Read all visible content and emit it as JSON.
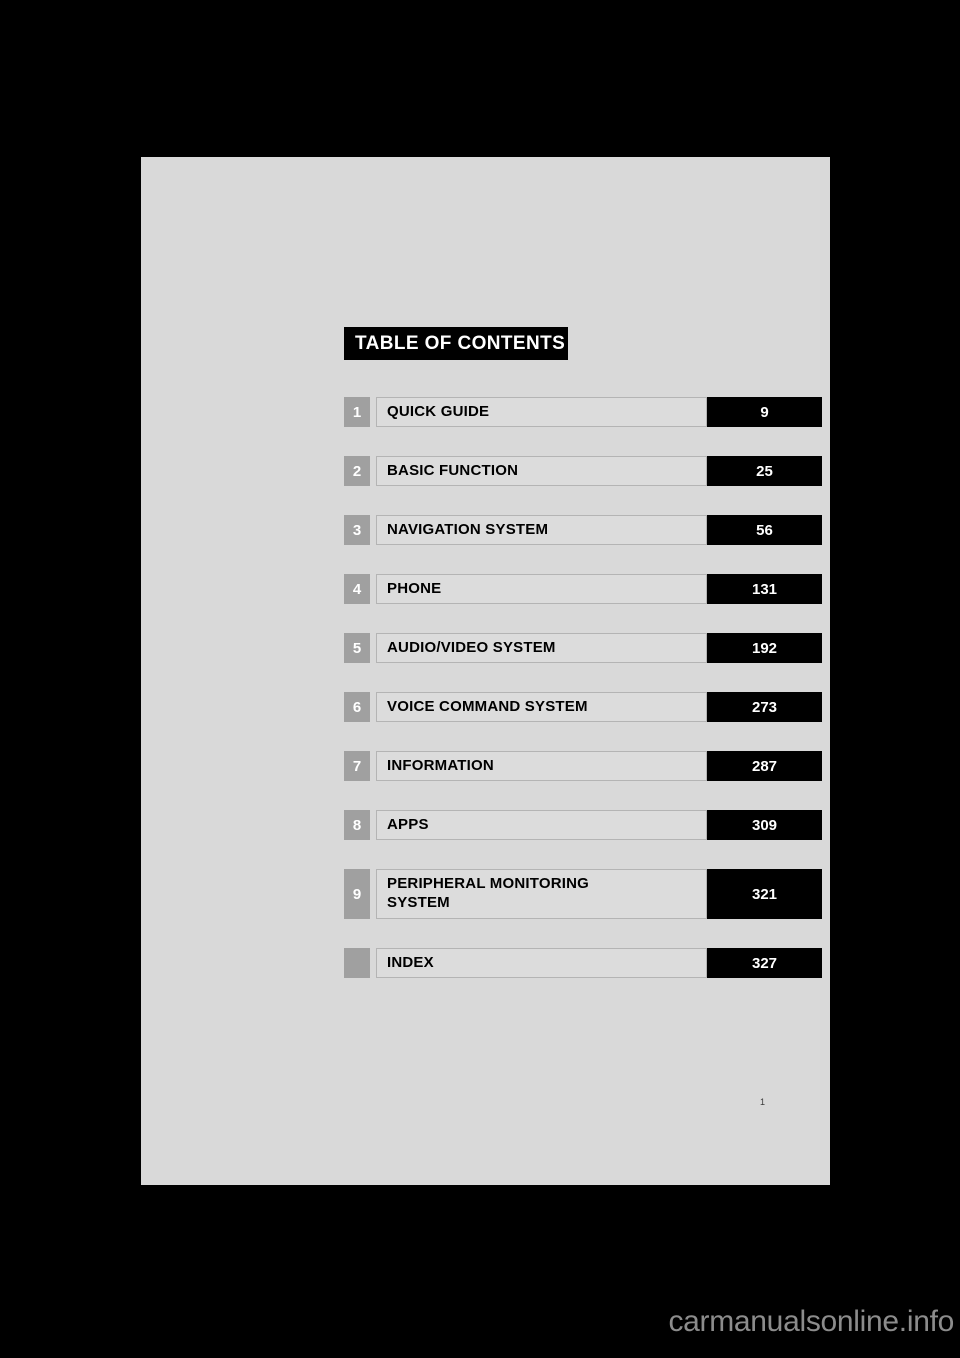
{
  "page": {
    "background_color": "#d9d9d9",
    "surround_color": "#000000",
    "folio": "1"
  },
  "banner": {
    "title": "TABLE OF CONTENTS"
  },
  "contents": {
    "rows": [
      {
        "number": "1",
        "title": "QUICK GUIDE",
        "page": "9"
      },
      {
        "number": "2",
        "title": "BASIC FUNCTION",
        "page": "25"
      },
      {
        "number": "3",
        "title": "NAVIGATION SYSTEM",
        "page": "56"
      },
      {
        "number": "4",
        "title": "PHONE",
        "page": "131"
      },
      {
        "number": "5",
        "title": "AUDIO/VIDEO SYSTEM",
        "page": "192"
      },
      {
        "number": "6",
        "title": "VOICE COMMAND SYSTEM",
        "page": "273"
      },
      {
        "number": "7",
        "title": "INFORMATION",
        "page": "287"
      },
      {
        "number": "8",
        "title": "APPS",
        "page": "309"
      },
      {
        "number": "9",
        "title": "PERIPHERAL MONITORING\nSYSTEM",
        "page": "321"
      },
      {
        "number": "",
        "title": "INDEX",
        "page": "327"
      }
    ]
  },
  "watermark": {
    "text": "carmanualsonline.info",
    "color": "#8c8c8c"
  }
}
